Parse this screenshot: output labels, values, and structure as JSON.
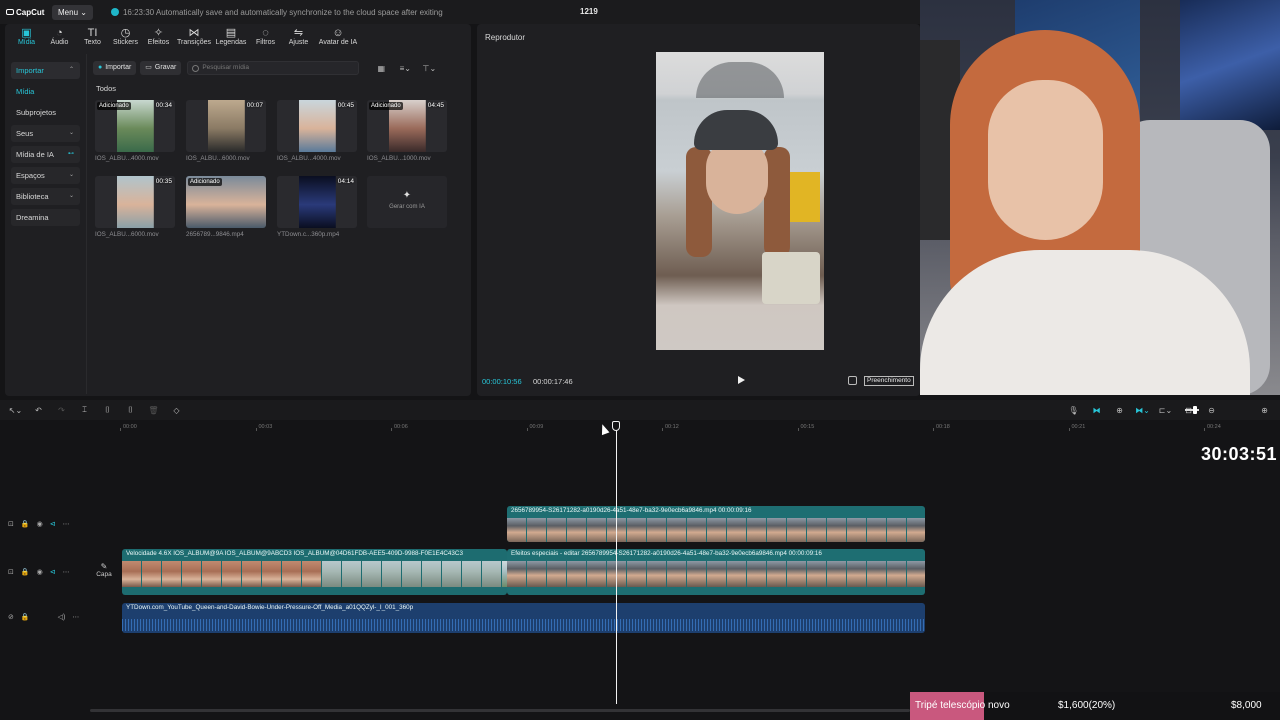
{
  "app": {
    "logo": "CapCut",
    "menu_label": "Menu",
    "save_status": "16:23:30 Automatically save and automatically synchronize to the cloud space after exiting",
    "project_name": "1219"
  },
  "toolbar_tabs": [
    {
      "label": "Mídia",
      "icon": "media-icon",
      "glyph": "▣",
      "active": true
    },
    {
      "label": "Áudio",
      "icon": "audio-icon",
      "glyph": "◔"
    },
    {
      "label": "Texto",
      "icon": "text-icon",
      "glyph": "TI"
    },
    {
      "label": "Stickers",
      "icon": "sticker-icon",
      "glyph": "◷"
    },
    {
      "label": "Efeitos",
      "icon": "effects-icon",
      "glyph": "✧"
    },
    {
      "label": "Transições",
      "icon": "transition-icon",
      "glyph": "⋈"
    },
    {
      "label": "Legendas",
      "icon": "captions-icon",
      "glyph": "▤"
    },
    {
      "label": "Filtros",
      "icon": "filter-icon",
      "glyph": "◌"
    },
    {
      "label": "Ajuste",
      "icon": "adjust-icon",
      "glyph": "⇋"
    },
    {
      "label": "Avatar de IA",
      "icon": "ai-avatar-icon",
      "glyph": "☺"
    }
  ],
  "sidebar": {
    "items": [
      {
        "label": "Importar",
        "style": "primary",
        "chevron": "⌃"
      },
      {
        "label": "Mídia",
        "style": "teal"
      },
      {
        "label": "Subprojetos",
        "style": "plain"
      },
      {
        "label": "Seus",
        "style": "boxed",
        "chevron": "⌄"
      },
      {
        "label": "Mídia de IA",
        "style": "boxed",
        "chevron": "⊷"
      },
      {
        "label": "Espaços",
        "style": "boxed",
        "chevron": "⌄"
      },
      {
        "label": "Biblioteca",
        "style": "boxed",
        "chevron": "⌄"
      },
      {
        "label": "Dreamina",
        "style": "boxed"
      }
    ]
  },
  "media": {
    "import_label": "Importar",
    "record_label": "Gravar",
    "search_placeholder": "Pesquisar mídia",
    "section_title": "Todos",
    "items": [
      {
        "name": "IOS_ALBU...4000.mov",
        "duration": "00:34",
        "badge": "Adicionado",
        "colors": [
          "#c8d8d0",
          "#6a8a5a",
          "#3a6a4a"
        ]
      },
      {
        "name": "IOS_ALBU...6000.mov",
        "duration": "00:07",
        "badge": "",
        "colors": [
          "#bda98e",
          "#8a7a64",
          "#2a2a2a"
        ]
      },
      {
        "name": "IOS_ALBU...4000.mov",
        "duration": "00:45",
        "badge": "",
        "colors": [
          "#c9d6dc",
          "#d9b39a",
          "#5a7a9a"
        ]
      },
      {
        "name": "IOS_ALBU...1000.mov",
        "duration": "04:45",
        "badge": "Adicionado",
        "colors": [
          "#d8d0cc",
          "#9a6a5a",
          "#3a2a2a"
        ]
      },
      {
        "name": "IOS_ALBU...6000.mov",
        "duration": "00:35",
        "badge": "",
        "colors": [
          "#b0c4cc",
          "#d9b39a",
          "#8aa0a8"
        ]
      },
      {
        "name": "2656789...9846.mp4",
        "duration": "",
        "badge": "Adicionado",
        "colors": [
          "#7a8a9a",
          "#d9b39a",
          "#4a5a6a"
        ]
      },
      {
        "name": "YTDown.c...360p.mp4",
        "duration": "04:14",
        "badge": "",
        "colors": [
          "#0a0e20",
          "#2a3a7a",
          "#0a0e20"
        ]
      }
    ],
    "generate_label": "Gerar com IA"
  },
  "player": {
    "title": "Reprodutor",
    "time_current": "00:00:10:56",
    "time_total": "00:00:17:46",
    "fill_label": "Preenchimento"
  },
  "timeline": {
    "ruler": [
      "00:00",
      "00:03",
      "00:06",
      "00:09",
      "00:12",
      "00:15",
      "00:18",
      "00:21",
      "00:24"
    ],
    "overlay_clip_label": "2656789954-S26171282-a0190d26-4a51-48e7-ba32-9e0ecb6a9846.mp4   00:00:09:16",
    "main_clip_a_label": "Velocidade 4.6X   IOS_ALBUM@9A   IOS_ALBUM@9ABCD3   IOS_ALBUM@04D61FDB-AEE5-409D-9988-F0E1E4C43C3",
    "main_clip_b_label": "Efeitos especiais - editar   2656789954-S26171282-a0190d26-4a51-48e7-ba32-9e0ecb6a9846.mp4   00:00:09:16",
    "audio_clip_label": "YTDown.com_YouTube_Queen-and-David-Bowie-Under-Pressure-Off_Media_a01QQZyl-_I_001_360p",
    "cover_label": "Capa"
  },
  "overlay": {
    "stream_timer": "30:03:51",
    "goal_label": "Tripé telescópio novo",
    "goal_current": "$1,600(20%)",
    "goal_target": "$8,000",
    "goal_progress": 0.2
  },
  "colors": {
    "accent": "#28c6d8",
    "clip_video": "#1e6e72",
    "clip_audio": "#1d3f6e",
    "goal": "#c9587e"
  }
}
